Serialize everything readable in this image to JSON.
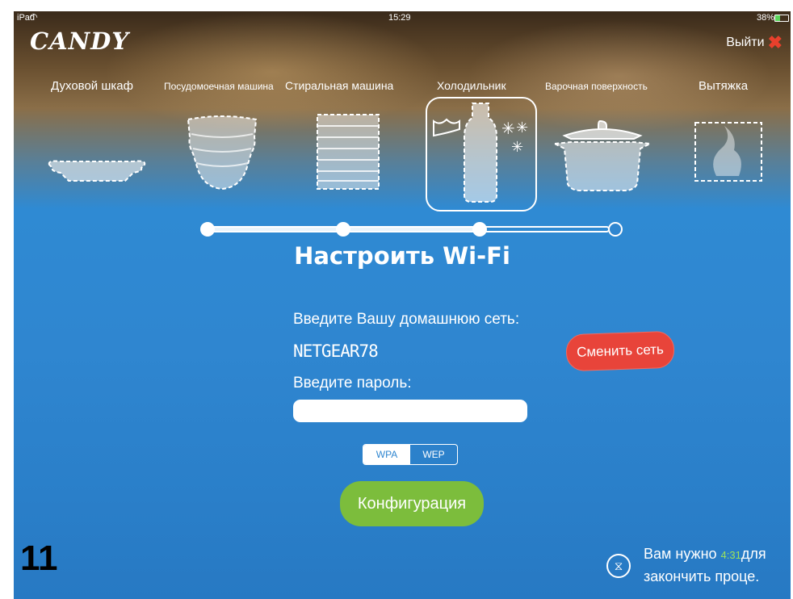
{
  "status_bar": {
    "device": "iPad",
    "time": "15:29",
    "battery": "38%"
  },
  "brand": {
    "logo": "CANDY"
  },
  "header": {
    "exit_label": "Выйти"
  },
  "categories": [
    {
      "label": "Духовой шкаф"
    },
    {
      "label": "Посудомоечная машина"
    },
    {
      "label": "Стиральная машина"
    },
    {
      "label": "Холодильник"
    },
    {
      "label": "Варочная поверхность"
    },
    {
      "label": "Вытяжка"
    }
  ],
  "selected_category": "Холодильник",
  "progress": {
    "total_steps": 4,
    "completed_steps": 3
  },
  "title": "Настроить Wi-Fi",
  "form": {
    "network_label": "Введите Вашу домашнюю сеть:",
    "network_value": "NETGEAR78",
    "change_network_label": "Сменить сеть",
    "password_label": "Введите пароль:",
    "password_value": "",
    "security_options": [
      "WPA",
      "WEP"
    ],
    "security_selected": "WPA",
    "configure_label": "Конфигурация"
  },
  "step_number": "11",
  "timer": {
    "prefix": "Вам нужно",
    "time_left": "4:31",
    "suffix": "для",
    "line2": "закончить проце."
  },
  "colors": {
    "accent_red": "#e8443a",
    "accent_green": "#7cbd3c",
    "bg_blue": "#2f86d0"
  }
}
